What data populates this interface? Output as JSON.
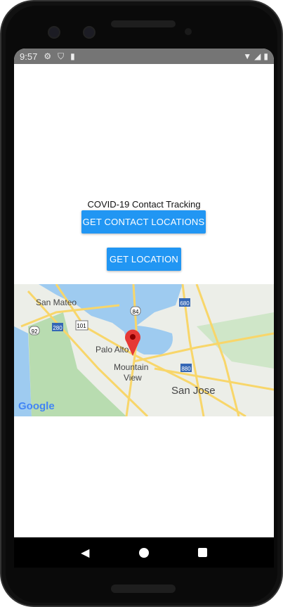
{
  "status_bar": {
    "time": "9:57",
    "icons": [
      "gear-icon",
      "play-protect-icon",
      "sd-card-icon"
    ],
    "right_icons": [
      "wifi-icon",
      "signal-icon",
      "battery-icon"
    ]
  },
  "app": {
    "title": "COVID-19 Contact Tracking",
    "get_contact_locations_label": "GET CONTACT LOCATIONS",
    "get_location_label": "GET LOCATION"
  },
  "map": {
    "labels": [
      "San Mateo",
      "Palo Alto",
      "Mountain View",
      "San Jose"
    ],
    "shields": [
      "680",
      "84",
      "280",
      "101",
      "92",
      "880"
    ],
    "logo": "Google",
    "marker_color": "#e53935"
  },
  "colors": {
    "button": "#2196f3",
    "status_bar": "#757575"
  },
  "nav_bar": {
    "buttons": [
      "back",
      "home",
      "recents"
    ]
  }
}
